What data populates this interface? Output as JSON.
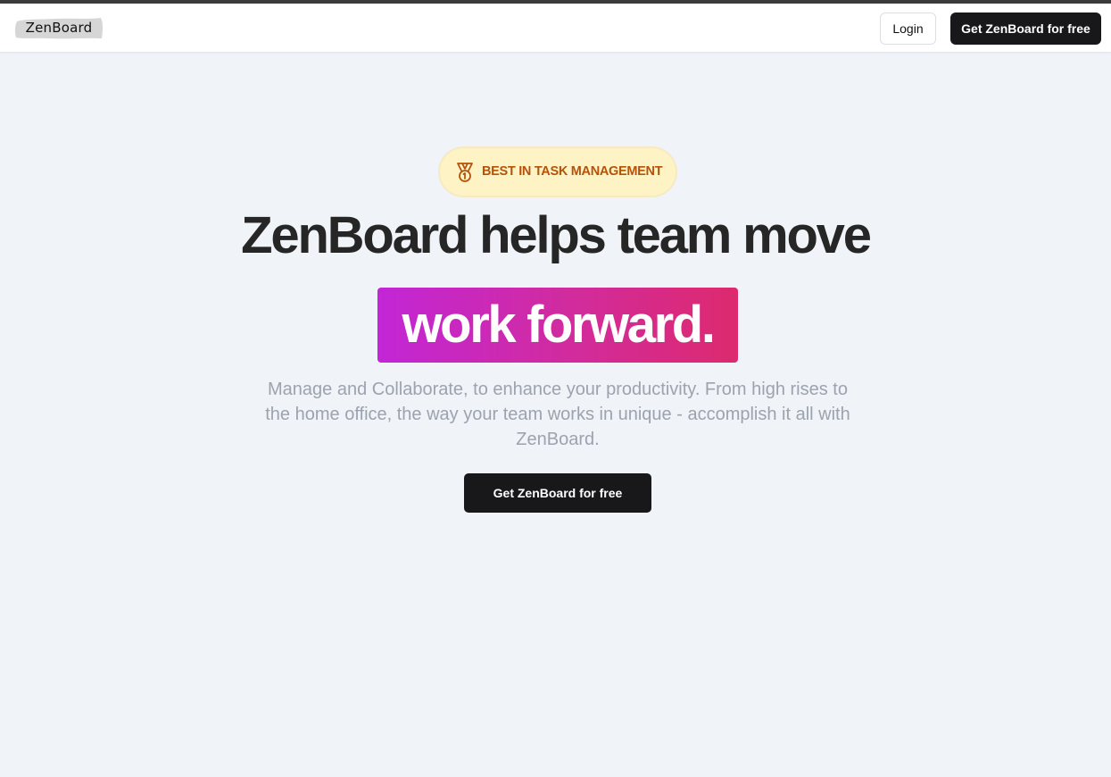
{
  "nav": {
    "logo_text": "ZenBoard",
    "login_label": "Login",
    "cta_label": "Get ZenBoard for free"
  },
  "hero": {
    "badge_icon": "medal-icon",
    "badge_text": "BEST IN TASK MANAGEMENT",
    "headline": "ZenBoard helps team move",
    "highlight": "work forward.",
    "subtext": "Manage and Collaborate, to enhance your productivity. From high rises to the home office, the way your team works in unique - accomplish it all with ZenBoard.",
    "cta_label": "Get ZenBoard for free"
  },
  "colors": {
    "page_bg": "#f0f3f7",
    "badge_bg": "#fdf3c4",
    "badge_text": "#b45309",
    "button_dark": "#18181b",
    "gradient_start": "#c226d6",
    "gradient_end": "#dd2a6e",
    "subtext": "#9ca3af"
  }
}
